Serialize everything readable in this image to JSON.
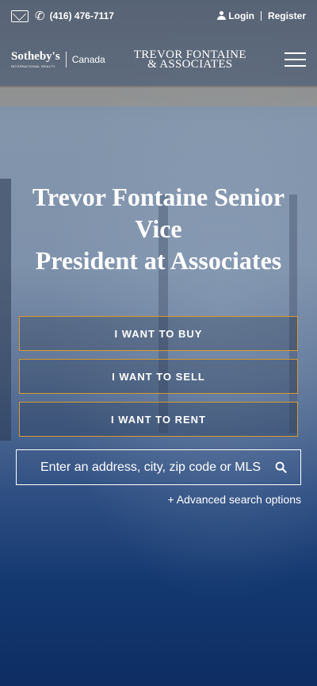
{
  "topbar": {
    "phone": "(416) 476-7117",
    "login_label": "Login",
    "register_label": "Register"
  },
  "logos": {
    "sothebys_name": "Sotheby's",
    "sothebys_sub": "INTERNATIONAL REALTY",
    "sothebys_region": "Canada",
    "brand_line1": "TREVOR FONTAINE",
    "brand_line2": "& ASSOCIATES"
  },
  "hero": {
    "title_line1": "Trevor Fontaine Senior",
    "title_line2": "Vice",
    "title_line3": "President at Associates"
  },
  "actions": {
    "buy_label": "I WANT TO BUY",
    "sell_label": "I WANT TO SELL",
    "rent_label": "I WANT TO RENT"
  },
  "search": {
    "placeholder": "Enter an address, city, zip code or MLS",
    "value": "",
    "advanced_label": "+ Advanced search options"
  },
  "colors": {
    "cta_border": "#d99a2e",
    "bg_bottom": "#0d2d63"
  }
}
